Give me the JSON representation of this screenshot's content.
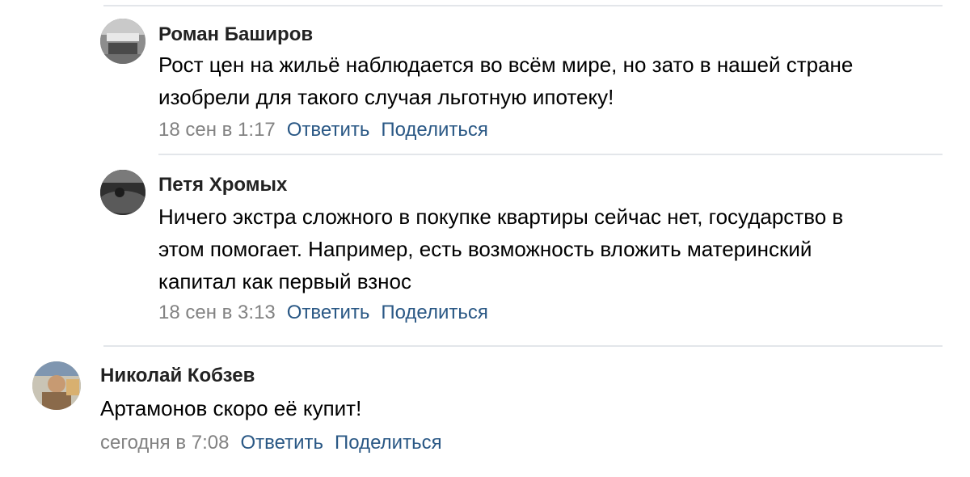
{
  "comments": [
    {
      "author": "Роман Баширов",
      "lines": [
        "Рост цен на жильё наблюдается во всём мире, но зато в нашей стране",
        "изобрели для такого случая льготную ипотеку!"
      ],
      "date": "18 сен в 1:17",
      "reply_label": "Ответить",
      "share_label": "Поделиться"
    },
    {
      "author": "Петя Хромых",
      "lines": [
        "Ничего экстра сложного в покупке квартиры сейчас нет, государство в",
        "этом помогает. Например, есть возможность вложить материнский",
        "капитал как первый взнос"
      ],
      "date": "18 сен в 3:13",
      "reply_label": "Ответить",
      "share_label": "Поделиться"
    },
    {
      "author": "Николай Кобзев",
      "lines": [
        "Артамонов скоро её купит!"
      ],
      "date": "сегодня в 7:08",
      "reply_label": "Ответить",
      "share_label": "Поделиться"
    }
  ]
}
